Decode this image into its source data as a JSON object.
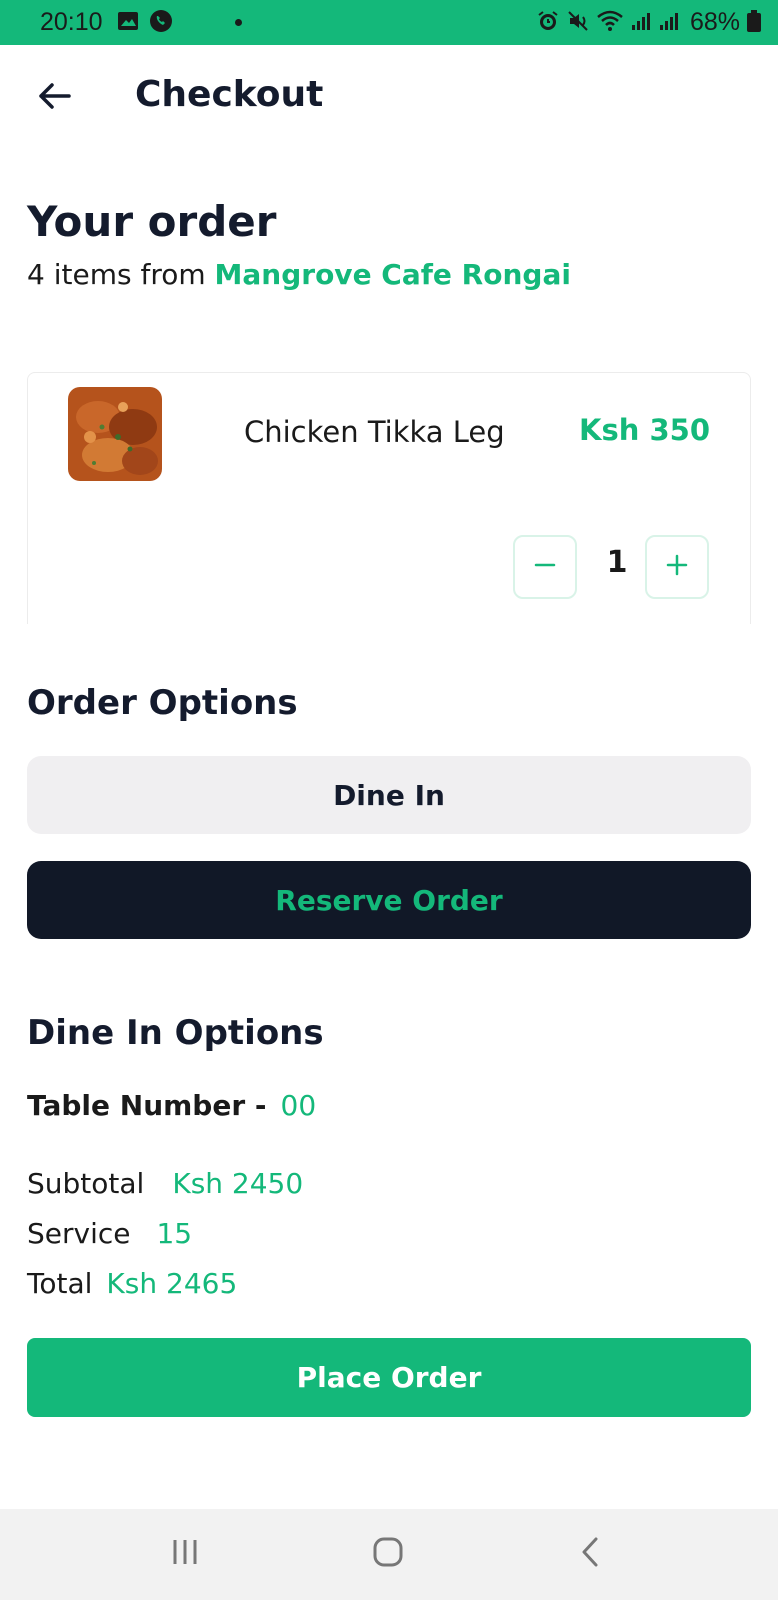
{
  "status_bar": {
    "time": "20:10",
    "battery": "68%",
    "icons": [
      "gallery-icon",
      "whatsapp-icon",
      "alarm-icon",
      "mute-icon",
      "wifi-icon",
      "signal-icon",
      "signal-icon",
      "battery-icon"
    ]
  },
  "header": {
    "title": "Checkout",
    "back_icon": "arrow-left-icon"
  },
  "order": {
    "heading": "Your order",
    "subtitle_prefix": "4 items from ",
    "restaurant": "Mangrove Cafe Rongai"
  },
  "item": {
    "name": "Chicken Tikka Leg",
    "price": "Ksh 350",
    "quantity": "1",
    "minus_icon": "minus-icon",
    "plus_icon": "plus-icon"
  },
  "order_options": {
    "heading": "Order Options",
    "dine_in": "Dine In",
    "reserve": "Reserve Order"
  },
  "dine_in_options": {
    "heading": "Dine In Options",
    "table_label": "Table Number -",
    "table_value": "00"
  },
  "summary": {
    "subtotal_label": "Subtotal",
    "subtotal_value": "Ksh 2450",
    "service_label": "Service",
    "service_value": "15",
    "total_label": "Total",
    "total_value": "Ksh 2465"
  },
  "actions": {
    "place_order": "Place Order"
  },
  "colors": {
    "accent": "#14b87a",
    "dark": "#111827",
    "text": "#141b2d",
    "option_bg": "#f0eff1"
  }
}
